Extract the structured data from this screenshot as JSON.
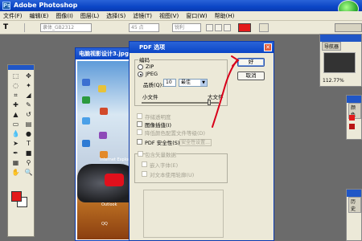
{
  "app": {
    "title": "Adobe Photoshop"
  },
  "menu": [
    "文件(F)",
    "编辑(E)",
    "图像(I)",
    "图层(L)",
    "选择(S)",
    "滤镜(T)",
    "视图(V)",
    "窗口(W)",
    "帮助(H)"
  ],
  "options": {
    "tool_label": "T",
    "font_family": "隶体_GB2312",
    "font_size": "45 点",
    "sharpness": "锐利"
  },
  "document": {
    "title": "电脑视影设计3.jpg",
    "icon_labels": [
      "Internet Explorer",
      "Outlook",
      "QQ"
    ]
  },
  "pdf_dialog": {
    "title": "PDF 选项",
    "encoding_group": "编码",
    "zip_label": "ZIP",
    "jpeg_label": "JPEG",
    "quality_label": "品质(Q):",
    "quality_value": "10",
    "quality_preset": "最佳",
    "small_file_label": "小文件",
    "large_file_label": "大文件",
    "ok_label": "好",
    "cancel_label": "取消",
    "save_transparency_label": "存储透明度",
    "image_interpolation_label": "图像插值(I)",
    "downsample_label": "降低颜色配置文件等级(D)",
    "pdf_security_label": "PDF 安全性(S)",
    "security_settings_label": "安全性设置...",
    "include_vector_label": "包含矢量数据",
    "embed_fonts_label": "嵌入字体(E)",
    "outline_text_label": "对文本使用轮廓(U)"
  },
  "panels": {
    "navigator_tab": "导航器",
    "zoom_level": "112.77%",
    "color_tab": "颜色",
    "history_tab": "历史"
  },
  "colors": {
    "foreground": "#e31a1a",
    "background": "#ffffff",
    "annotation": "#d8001a"
  }
}
